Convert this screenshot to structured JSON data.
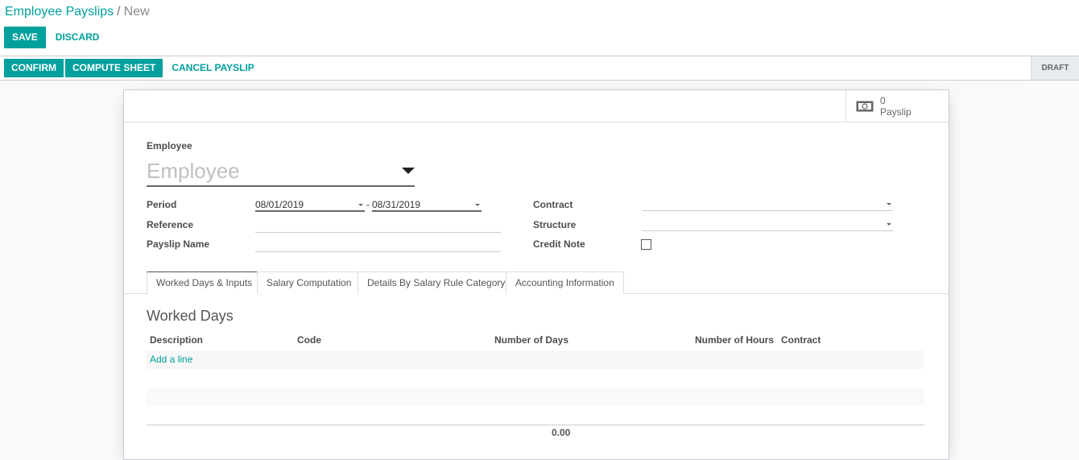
{
  "breadcrumb": {
    "parent": "Employee Payslips",
    "separator": "/",
    "current": "New"
  },
  "toolbar": {
    "save_label": "SAVE",
    "discard_label": "DISCARD"
  },
  "statusbar": {
    "confirm_label": "CONFIRM",
    "compute_label": "COMPUTE SHEET",
    "cancel_label": "CANCEL PAYSLIP",
    "status": "DRAFT"
  },
  "stat_button": {
    "count": "0",
    "label": "Payslip",
    "icon": "money-icon"
  },
  "form": {
    "employee_label": "Employee",
    "employee_placeholder": "Employee",
    "period_label": "Period",
    "period_from": "08/01/2019",
    "period_sep": "-",
    "period_to": "08/31/2019",
    "reference_label": "Reference",
    "reference_value": "",
    "payslip_name_label": "Payslip Name",
    "payslip_name_value": "",
    "contract_label": "Contract",
    "contract_value": "",
    "structure_label": "Structure",
    "structure_value": "",
    "credit_note_label": "Credit Note",
    "credit_note_checked": false
  },
  "tabs": [
    {
      "label": "Worked Days & Inputs",
      "active": true
    },
    {
      "label": "Salary Computation",
      "active": false
    },
    {
      "label": "Details By Salary Rule Category",
      "active": false
    },
    {
      "label": "Accounting Information",
      "active": false
    }
  ],
  "worked_days": {
    "title": "Worked Days",
    "columns": [
      "Description",
      "Code",
      "Number of Days",
      "Number of Hours",
      "Contract"
    ],
    "add_line_label": "Add a line",
    "total_days": "0.00"
  }
}
